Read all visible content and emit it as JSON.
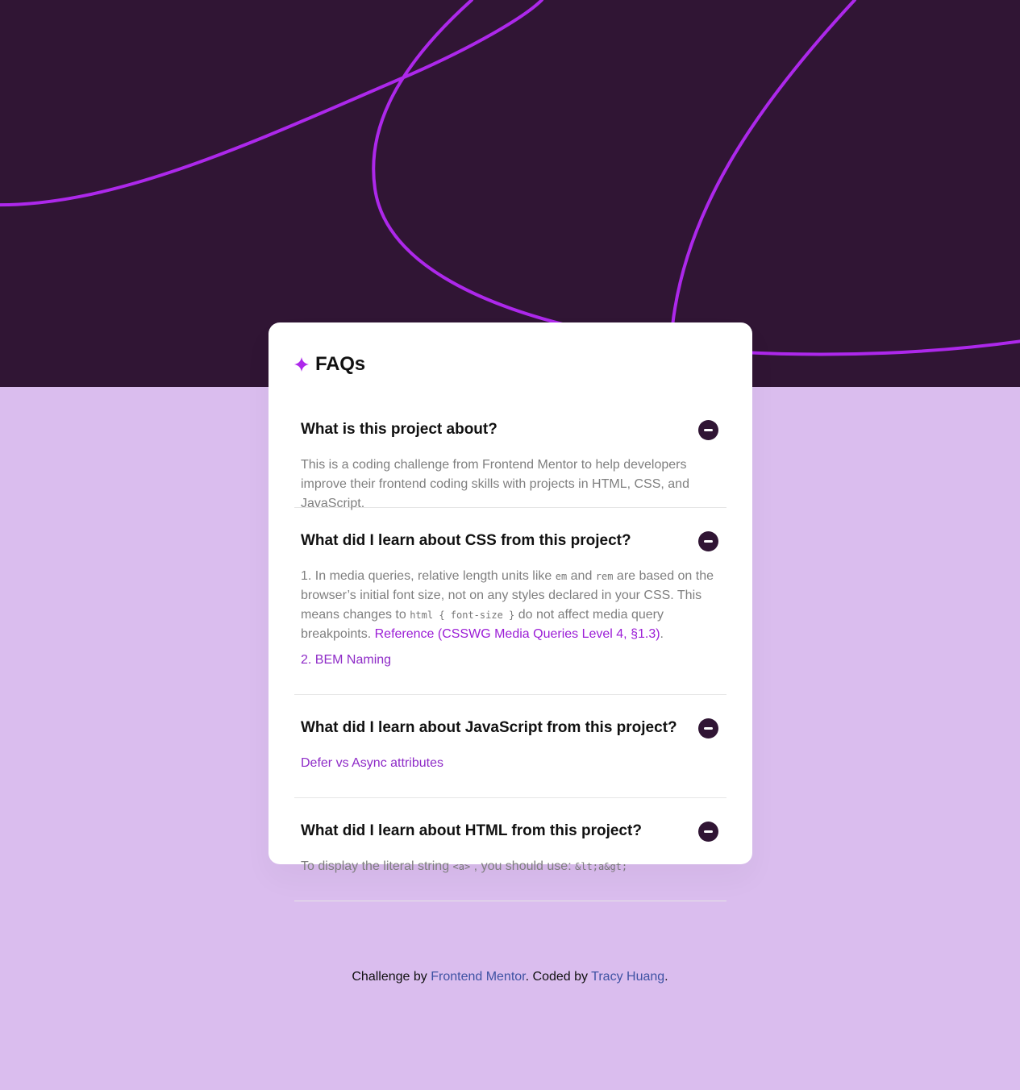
{
  "hero": {
    "background_color": "#301534",
    "stroke_color": "#ad28eb"
  },
  "card": {
    "title": "FAQs",
    "title_icon": "star-icon",
    "accent": "#ad28eb"
  },
  "faqs": [
    {
      "question": "What is this project about?",
      "answer": "This is a coding challenge from Frontend Mentor to help developers improve their frontend coding skills with projects in HTML, CSS, and JavaScript.",
      "toggle_icon": "minus-icon"
    },
    {
      "question": "What did I learn about CSS from this project?",
      "answer_parts": {
        "text1": "1. In media queries, relative length units like ",
        "code1": "em",
        "text2": " and ",
        "code2": "rem",
        "text3": " are based on the browser’s initial font size, not on any styles declared in your CSS. This means changes to ",
        "code3": "html { font-size }",
        "text4": " do not affect media query breakpoints. ",
        "link": "Reference (CSSWG Media Queries Level 4, §1.3)",
        "text5": ".",
        "extra_link": "2. BEM Naming"
      },
      "toggle_icon": "minus-icon"
    },
    {
      "question": "What did I learn about JavaScript from this project?",
      "answer_link": "Defer vs Async attributes",
      "toggle_icon": "minus-icon"
    },
    {
      "question": "What did I learn about HTML from this project?",
      "answer_parts": {
        "text1": "To display the literal string ",
        "code1": "<a>",
        "text2": ", you should use: ",
        "code2": "&lt;a&gt;"
      },
      "toggle_icon": "minus-icon"
    }
  ],
  "footer": {
    "prefix": "Challenge by ",
    "mentor_link": "Frontend Mentor",
    "middle": ". Coded by ",
    "author_link": "Tracy Huang",
    "suffix": "."
  }
}
